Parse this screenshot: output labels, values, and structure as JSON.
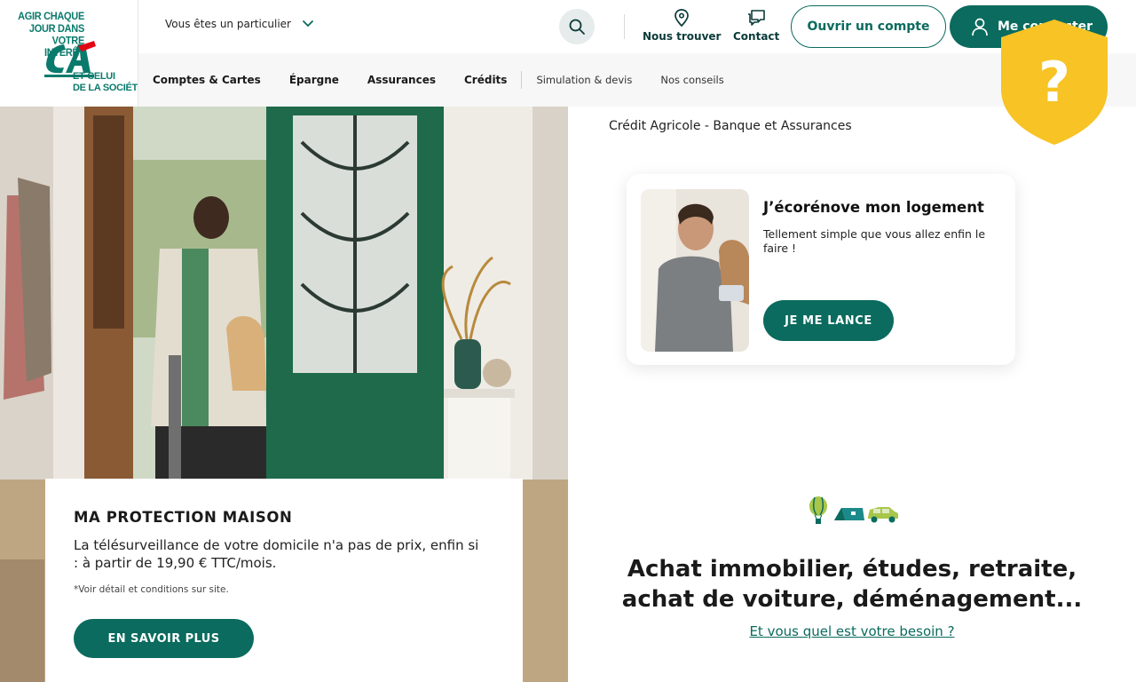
{
  "logo": {
    "tagline_top": [
      "AGIR CHAQUE",
      "JOUR DANS VOTRE",
      "INTÉRÊT"
    ],
    "tagline_bottom": [
      "ET CELUI",
      "DE LA SOCIÉTÉ"
    ],
    "mark": "CA"
  },
  "header": {
    "profile_select": "Vous êtes un particulier",
    "nous_trouver": "Nous trouver",
    "contact": "Contact",
    "ouvrir_compte": "Ouvrir un compte",
    "me_connecter": "Me connecter"
  },
  "nav": {
    "items": [
      "Comptes & Cartes",
      "Épargne",
      "Assurances",
      "Crédits",
      "Simulation & devis",
      "Nos conseils"
    ]
  },
  "badge": {
    "symbol": "?"
  },
  "hero": {
    "card": {
      "title": "MA PROTECTION MAISON",
      "text": "La télésurveillance de votre domicile n'a pas de prix, enfin si : à partir de 19,90 € TTC/mois.",
      "note": "*Voir détail et conditions sur site.",
      "button": "EN SAVOIR PLUS"
    }
  },
  "brand_title": "Crédit Agricole - Banque et Assurances",
  "renov": {
    "title": "J’écorénove mon logement",
    "text": "Tellement simple que vous allez enfin le faire !",
    "button": "JE ME LANCE"
  },
  "needs": {
    "title": "Achat immobilier, études, retraite, achat de voiture, déménagement...",
    "link": "Et vous quel est votre besoin ?"
  },
  "colors": {
    "brand_green": "#0a6b5e",
    "badge_yellow": "#f7c325",
    "nav_bg": "#f7f7f7",
    "logo_red": "#e30613"
  }
}
